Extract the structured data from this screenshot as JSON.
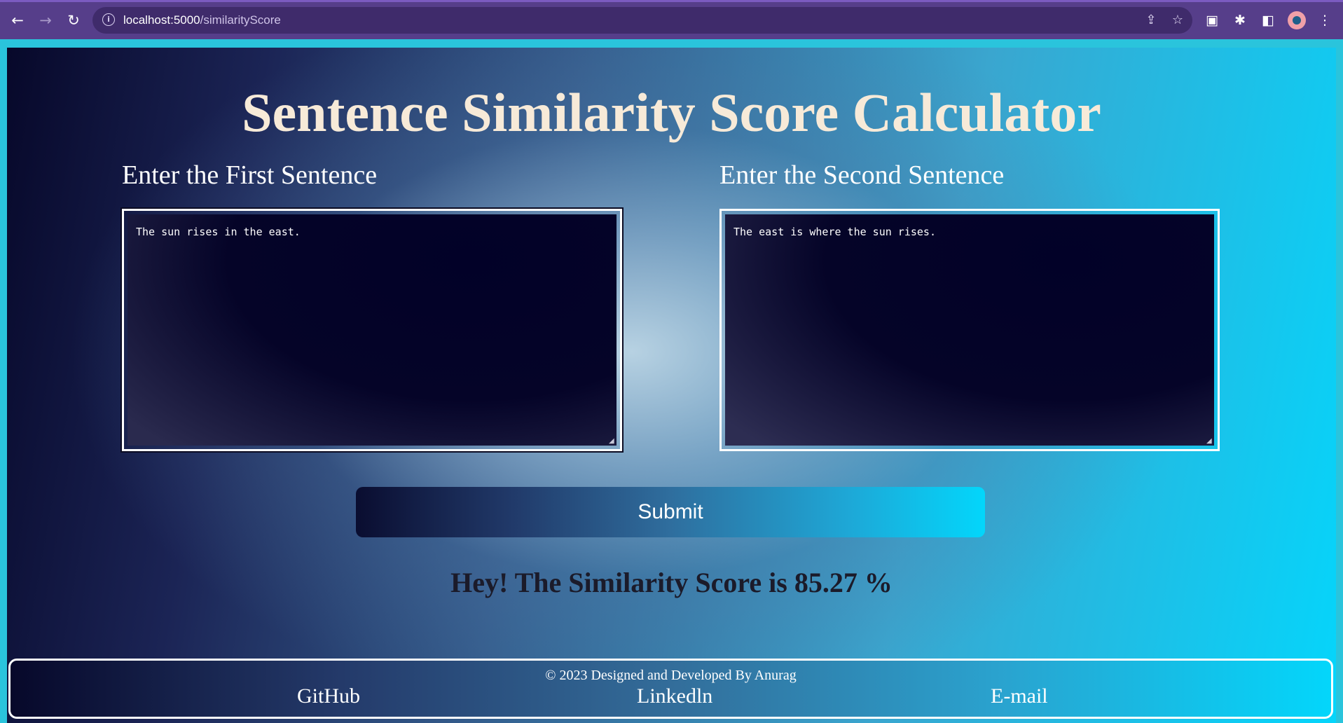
{
  "browser": {
    "url_host": "localhost:5000",
    "url_path": "/similarityScore",
    "icons": [
      "back-arrow-icon",
      "forward-arrow-icon",
      "reload-icon",
      "info-icon",
      "share-icon",
      "star-icon",
      "media-icon",
      "extensions-icon",
      "sidepanel-icon",
      "avatar",
      "menu-icon"
    ]
  },
  "page": {
    "title": "Sentence Similarity Score Calculator",
    "first_label": "Enter the First Sentence",
    "second_label": "Enter the Second Sentence",
    "first_value": "The sun rises in the east.",
    "second_value": "The east is where the sun rises.",
    "submit_label": "Submit",
    "result_text": "Hey! The Similarity Score is 85.27 %"
  },
  "footer": {
    "copyright": "© 2023 Designed and Developed By Anurag",
    "links": [
      "GitHub",
      "Linkedln",
      "E-mail"
    ]
  },
  "colors": {
    "chrome": "#563e8a",
    "title": "#f7ead8",
    "textarea_bg": "#050428",
    "accent": "#03d6fb"
  }
}
